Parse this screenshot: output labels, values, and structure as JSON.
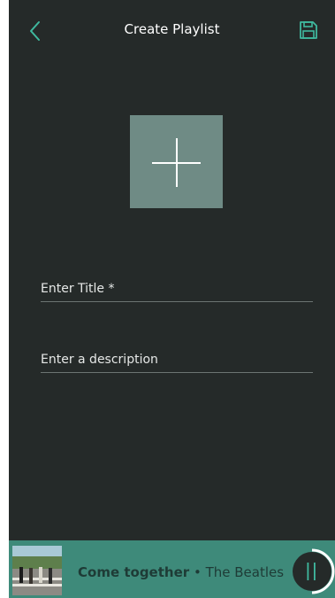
{
  "header": {
    "title": "Create Playlist",
    "back_icon": "chevron-left-icon",
    "save_icon": "floppy-disk-icon"
  },
  "cover": {
    "icon": "plus-icon",
    "background": "#6f8b85"
  },
  "form": {
    "title_placeholder": "Enter Title *",
    "description_placeholder": "Enter a description"
  },
  "player": {
    "song": "Come together",
    "separator": "•",
    "artist": "The Beatles",
    "control_icon": "pause-icon"
  },
  "colors": {
    "background": "#252a29",
    "accent": "#3fb99f",
    "player_bar": "#3e8a7a"
  }
}
